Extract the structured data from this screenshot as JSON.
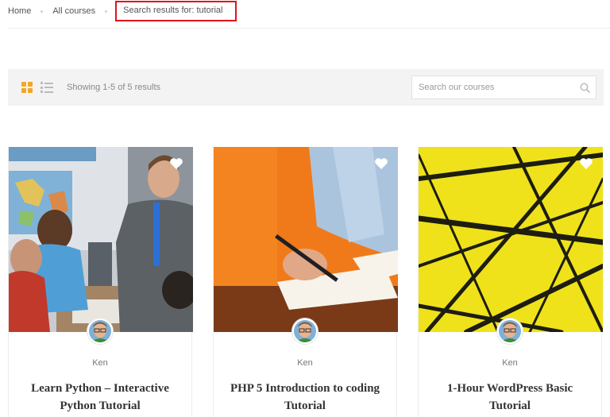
{
  "breadcrumb": {
    "home": "Home",
    "all_courses": "All courses",
    "current": "Search results for: tutorial"
  },
  "toolbar": {
    "result_count": "Showing 1-5 of 5 results",
    "search_placeholder": "Search our courses",
    "grid_view_icon": "grid-view-icon",
    "list_view_icon": "list-view-icon",
    "accent_color": "#f5a623"
  },
  "courses": [
    {
      "author": "Ken",
      "title": "Learn Python – Interactive Python Tutorial",
      "image": "classroom-teacher-students"
    },
    {
      "author": "Ken",
      "title": "PHP 5 Introduction to coding Tutorial",
      "image": "hand-writing-notebook"
    },
    {
      "author": "Ken",
      "title": "1-Hour WordPress Basic Tutorial",
      "image": "yellow-abstract-lines"
    }
  ],
  "colors": {
    "highlight_border": "#e0141e",
    "toolbar_bg": "#f3f3f3"
  }
}
